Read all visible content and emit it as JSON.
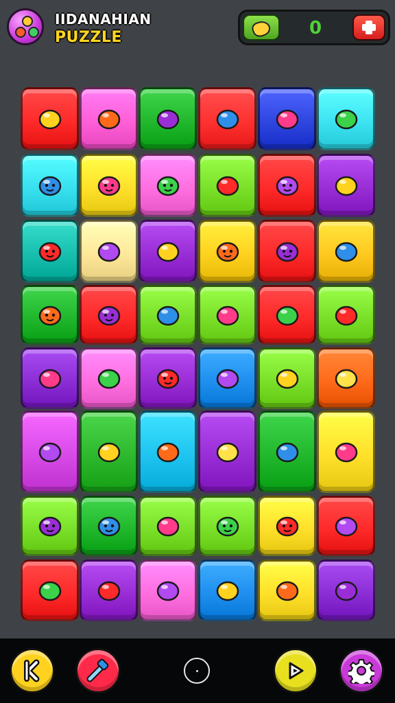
{
  "header": {
    "title_line1": "IIDANAHIAN",
    "title_line2": "PUZZLE",
    "logo_icon": "candy-cluster-icon",
    "score": "0",
    "score_icon": "candy-icon",
    "menu_icon": "plus-menu-icon"
  },
  "board": {
    "columns": 6,
    "rows": [
      [
        {
          "color": "#ff2a2a",
          "icon": "lemon"
        },
        {
          "color": "#ff5fd7",
          "icon": "chili"
        },
        {
          "color": "#22b82e",
          "icon": "map-pin"
        },
        {
          "color": "#ff3131",
          "icon": "pencil"
        },
        {
          "color": "#2f46e0",
          "icon": "crayon"
        },
        {
          "color": "#3ee3f2",
          "icon": "balloon"
        }
      ],
      [
        {
          "color": "#38e0f0",
          "icon": "bug-face"
        },
        {
          "color": "#ffe02a",
          "icon": "blob-face"
        },
        {
          "color": "#ff6fe0",
          "icon": "smile-face"
        },
        {
          "color": "#7be02a",
          "icon": "lollipop"
        },
        {
          "color": "#ff2a2a",
          "icon": "star-face"
        },
        {
          "color": "#9a2ed6",
          "icon": "leaf-brush"
        }
      ],
      [
        {
          "color": "#18bfae",
          "icon": "fish"
        },
        {
          "color": "#ffe89a",
          "icon": "splat"
        },
        {
          "color": "#9a2ed6",
          "icon": "triangle-toy"
        },
        {
          "color": "#ffd21f",
          "icon": "sun-face"
        },
        {
          "color": "#ff2a2a",
          "icon": "sun-face"
        },
        {
          "color": "#ffc81f",
          "icon": "snail"
        }
      ],
      [
        {
          "color": "#22b82e",
          "icon": "ladybug"
        },
        {
          "color": "#ff2a2a",
          "icon": "fish-blue"
        },
        {
          "color": "#7be02a",
          "icon": "crayon-green"
        },
        {
          "color": "#7be02a",
          "icon": "crayon-red"
        },
        {
          "color": "#ff2a2a",
          "icon": "balloon-pink"
        },
        {
          "color": "#7be02a",
          "icon": "brush-blue"
        }
      ],
      [
        {
          "color": "#8c2ed6",
          "icon": "notepad"
        },
        {
          "color": "#ff6fe0",
          "icon": "ring"
        },
        {
          "color": "#9a2ed6",
          "icon": "lemon-face"
        },
        {
          "color": "#1f8ff0",
          "icon": "carrot"
        },
        {
          "color": "#7be02a",
          "icon": "pencil-yellow"
        },
        {
          "color": "#ff6a1a",
          "icon": "flag"
        }
      ],
      [
        {
          "color": "#d84ae8",
          "icon": "potion"
        },
        {
          "color": "#2eb82e",
          "icon": "red-bulb"
        },
        {
          "color": "#1fc4f0",
          "icon": "yellow-bulb"
        },
        {
          "color": "#9a2ed6",
          "icon": "teapot"
        },
        {
          "color": "#22b82e",
          "icon": "robot"
        },
        {
          "color": "#ffe02a",
          "icon": "gift-tag"
        }
      ],
      [
        {
          "color": "#7be02a",
          "icon": "crab"
        },
        {
          "color": "#22b82e",
          "icon": "star-blob"
        },
        {
          "color": "#7be02a",
          "icon": "rocket"
        },
        {
          "color": "#7be02a",
          "icon": "pig"
        },
        {
          "color": "#ffe02a",
          "icon": "ghost"
        },
        {
          "color": "#ff2a2a",
          "icon": "lollipop-blue"
        }
      ],
      [
        {
          "color": "#ff2a2a",
          "icon": "spinning-top"
        },
        {
          "color": "#9a2ed6",
          "icon": "shell"
        },
        {
          "color": "#ff6fe0",
          "icon": "magnifier"
        },
        {
          "color": "#1f8ff0",
          "icon": "notepad-pink"
        },
        {
          "color": "#ffe02a",
          "icon": "crayon-teal"
        },
        {
          "color": "#8c2ed6",
          "icon": "magnifier-purple"
        }
      ]
    ]
  },
  "bottom_bar": {
    "buttons": [
      {
        "name": "back-button",
        "icon": "back-arrow-icon",
        "color": "#ffd21f"
      },
      {
        "name": "hint-button",
        "icon": "hammer-icon",
        "color": "#ff2a4a"
      },
      {
        "name": "home-button",
        "icon": "home-circle-icon",
        "color": "#060708"
      },
      {
        "name": "play-button",
        "icon": "play-arrow-icon",
        "color": "#e8e01f"
      },
      {
        "name": "settings-button",
        "icon": "gear-icon",
        "color": "#c93ad9"
      }
    ]
  }
}
